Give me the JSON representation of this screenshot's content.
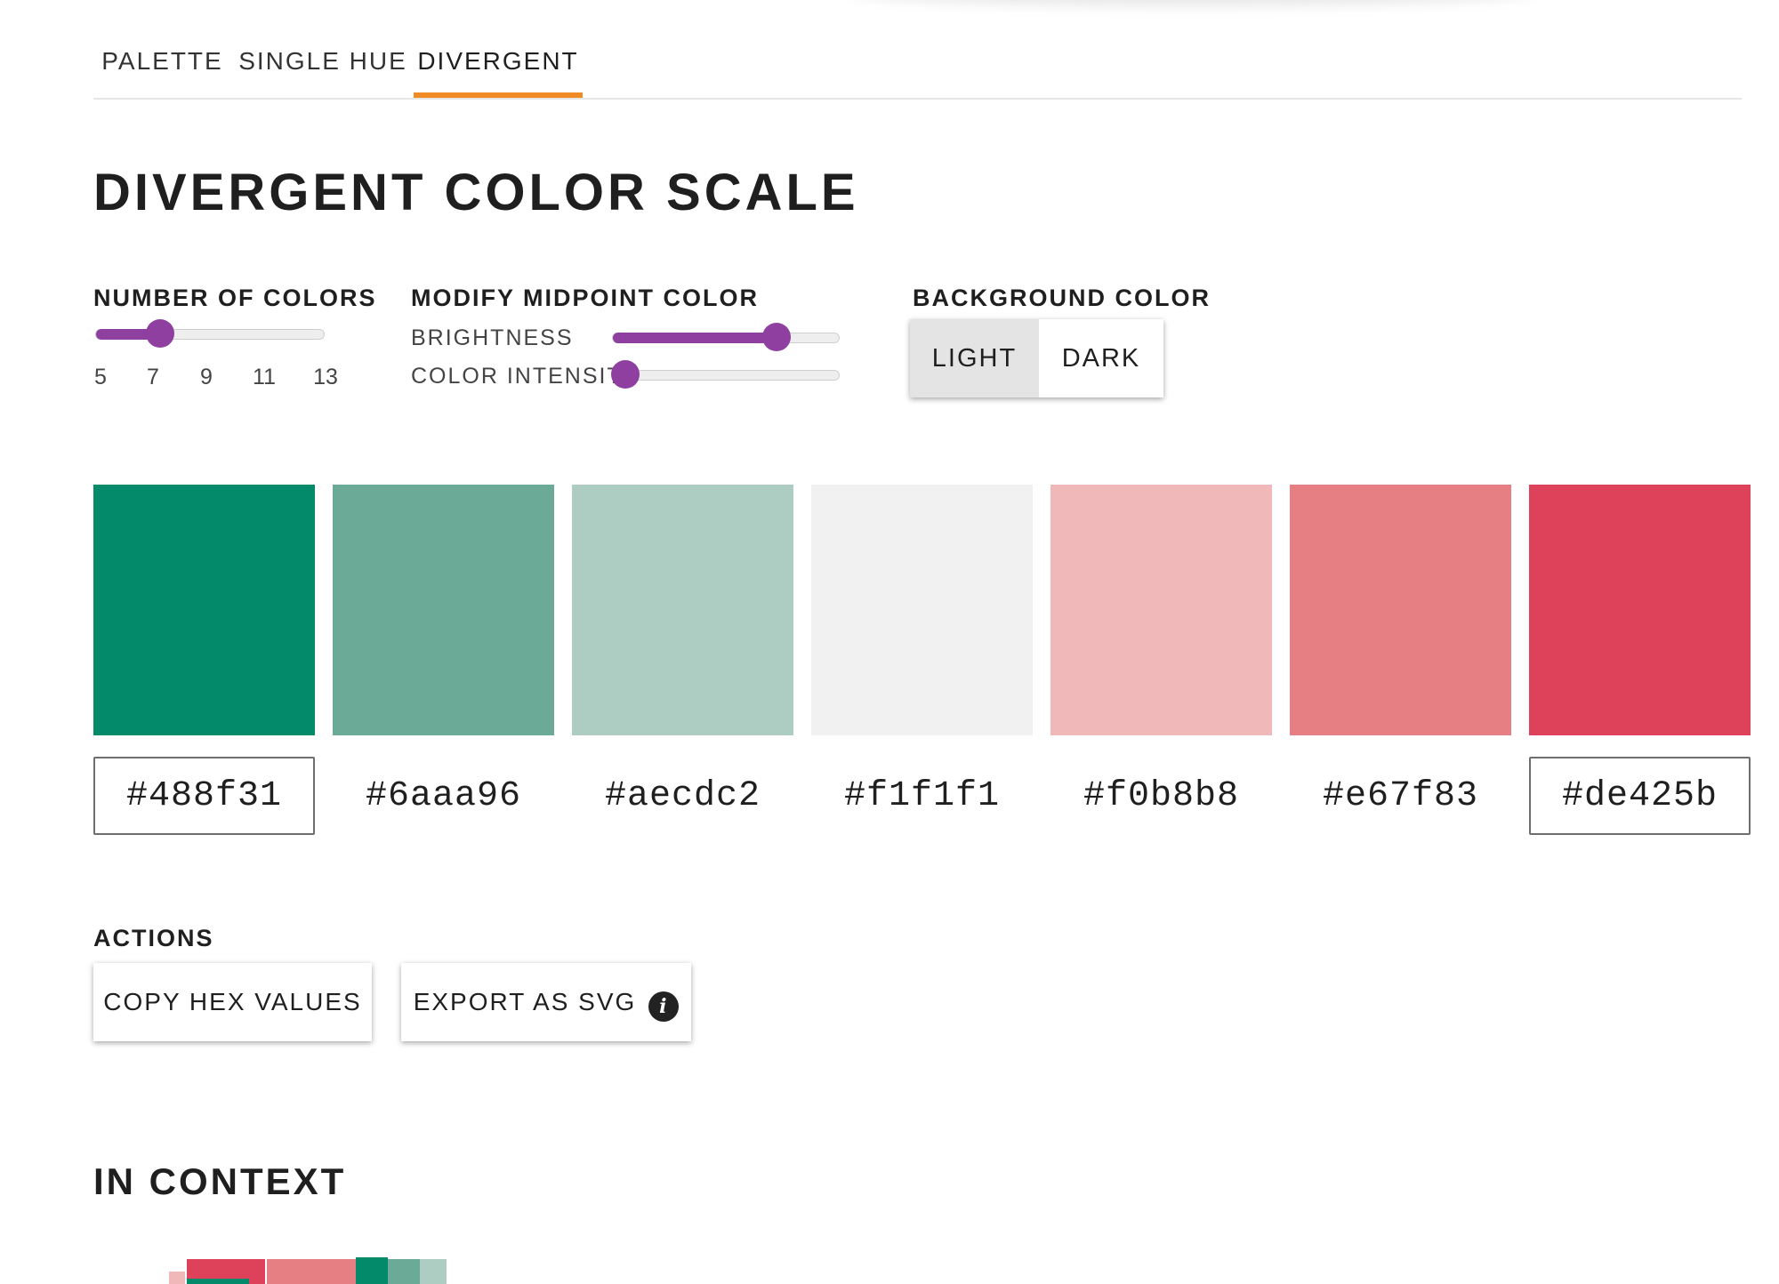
{
  "tabs": [
    {
      "label": "PALETTE",
      "active": false
    },
    {
      "label": "SINGLE HUE",
      "active": false
    },
    {
      "label": "DIVERGENT",
      "active": true
    }
  ],
  "page_title": "DIVERGENT COLOR SCALE",
  "number_of_colors": {
    "label": "NUMBER OF COLORS",
    "ticks": [
      "5",
      "7",
      "9",
      "11",
      "13"
    ],
    "value": 7
  },
  "midpoint": {
    "label": "MODIFY MIDPOINT COLOR",
    "brightness": {
      "label": "BRIGHTNESS",
      "fraction": 0.72
    },
    "intensity": {
      "label": "COLOR INTENSITY",
      "fraction": 0.0
    }
  },
  "background": {
    "label": "BACKGROUND COLOR",
    "options": [
      "LIGHT",
      "DARK"
    ],
    "selected": "LIGHT"
  },
  "swatches": [
    {
      "hex": "#488f31",
      "display": "#028a6b",
      "boxed": true
    },
    {
      "hex": "#6aaa96",
      "display": "#6aaa96",
      "boxed": false
    },
    {
      "hex": "#aecdc2",
      "display": "#aecdc2",
      "boxed": false
    },
    {
      "hex": "#f1f1f1",
      "display": "#f1f1f1",
      "boxed": false
    },
    {
      "hex": "#f0b8b8",
      "display": "#f0b8b8",
      "boxed": false
    },
    {
      "hex": "#e67f83",
      "display": "#e67f83",
      "boxed": false
    },
    {
      "hex": "#de425b",
      "display": "#de425b",
      "boxed": true
    }
  ],
  "actions": {
    "label": "ACTIONS",
    "copy": "COPY HEX VALUES",
    "export": "EXPORT AS SVG",
    "info_icon": "info-icon"
  },
  "in_context": {
    "label": "IN CONTEXT"
  },
  "colors": {
    "accent_tab": "#f08a24",
    "slider": "#8e3fa0"
  }
}
